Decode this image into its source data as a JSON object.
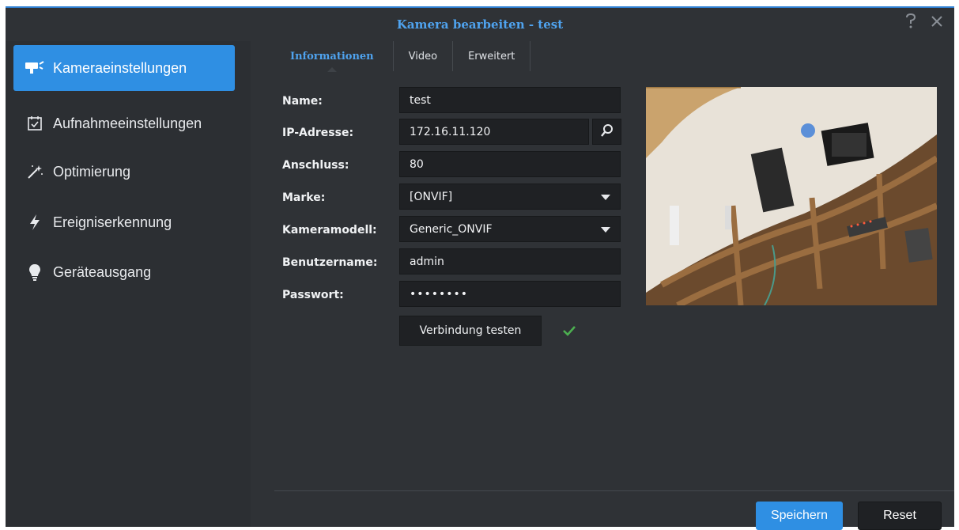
{
  "window": {
    "title": "Kamera bearbeiten - test",
    "help_icon": "help-icon",
    "close_icon": "close-icon",
    "accent": "#2f8fe3",
    "title_color": "#4fa3ef"
  },
  "sidebar": {
    "items": [
      {
        "label": "Kameraeinstellungen",
        "icon": "camera-icon",
        "active": true
      },
      {
        "label": "Aufnahmeeinstellungen",
        "icon": "calendar-check-icon",
        "active": false
      },
      {
        "label": "Optimierung",
        "icon": "magic-wand-icon",
        "active": false
      },
      {
        "label": "Ereigniserkennung",
        "icon": "lightning-icon",
        "active": false
      },
      {
        "label": "Geräteausgang",
        "icon": "bulb-icon",
        "active": false
      }
    ]
  },
  "tabs": [
    {
      "label": "Informationen",
      "active": true
    },
    {
      "label": "Video",
      "active": false
    },
    {
      "label": "Erweitert",
      "active": false
    }
  ],
  "form": {
    "name": {
      "label": "Name:",
      "value": "test"
    },
    "ip": {
      "label": "IP-Adresse:",
      "value": "172.16.11.120"
    },
    "port": {
      "label": "Anschluss:",
      "value": "80"
    },
    "brand": {
      "label": "Marke:",
      "value": "[ONVIF]"
    },
    "model": {
      "label": "Kameramodell:",
      "value": "Generic_ONVIF"
    },
    "username": {
      "label": "Benutzername:",
      "value": "admin"
    },
    "password": {
      "label": "Passwort:",
      "value": "••••••••"
    },
    "test_button": "Verbindung testen",
    "test_status_icon": "checkmark-icon",
    "test_status_color": "#4caf50"
  },
  "footer": {
    "save_label": "Speichern",
    "reset_label": "Reset"
  }
}
